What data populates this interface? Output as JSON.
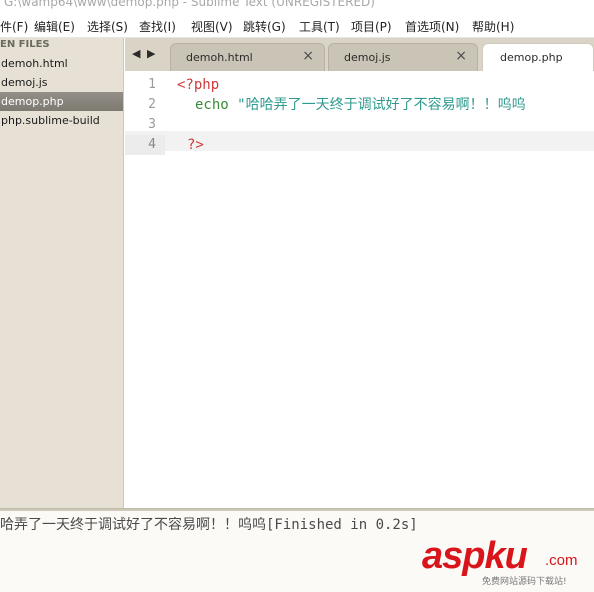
{
  "window": {
    "title": "G:\\wamp64\\www\\demop.php - Sublime Text (UNREGISTERED)"
  },
  "menu": {
    "items": [
      "件(F)",
      "编辑(E)",
      "选择(S)",
      "查找(I)",
      "视图(V)",
      "跳转(G)",
      "工具(T)",
      "项目(P)",
      "首选项(N)",
      "帮助(H)"
    ]
  },
  "sidebar": {
    "header": "EN FILES",
    "files": [
      "demoh.html",
      "demoj.js",
      "demop.php",
      "php.sublime-build"
    ],
    "active_index": 2
  },
  "tabs": {
    "nav_left": "◀",
    "nav_right": "▶",
    "items": [
      {
        "label": "demoh.html",
        "close": "×"
      },
      {
        "label": "demoj.js",
        "close": "×"
      },
      {
        "label": "demop.php",
        "close": ""
      }
    ],
    "active_index": 2
  },
  "editor": {
    "line_numbers": [
      "1",
      "2",
      "3",
      "4"
    ],
    "current_line": 4,
    "lines": {
      "l1_tag": "<?php",
      "l2_kw": "echo",
      "l2_str": "\"哈哈弄了一天终于调试好了不容易啊！！呜呜",
      "l4_tag": "?>"
    }
  },
  "output": {
    "text": "哈弄了一天终于调试好了不容易啊！！呜呜[Finished in 0.2s]"
  },
  "watermark": {
    "brand": "aspku",
    "domain": ".com",
    "subtitle": "免费网站源码下载站!"
  },
  "colors": {
    "php_tag": "#d03a3a",
    "keyword": "#3a8a3a",
    "string": "#2f9a8e",
    "watermark": "#d9151b"
  }
}
